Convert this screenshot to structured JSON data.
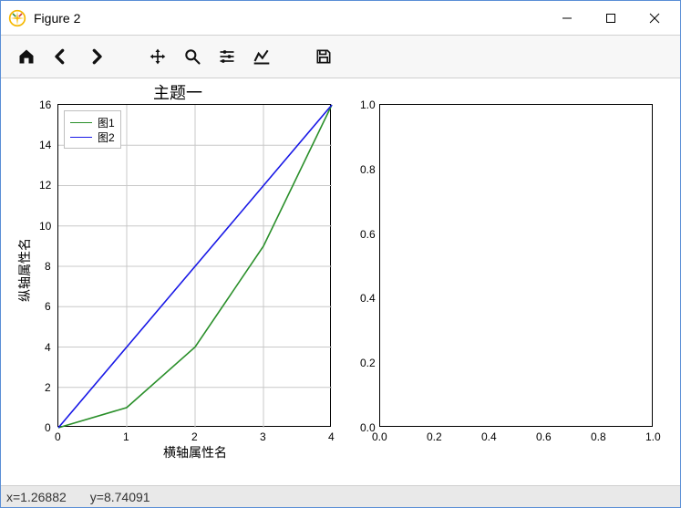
{
  "window": {
    "title": "Figure 2"
  },
  "toolbar": {
    "home": "Home",
    "back": "Back",
    "forward": "Forward",
    "pan": "Pan",
    "zoom": "Zoom",
    "subplots": "Configure subplots",
    "axes": "Edit axes",
    "save": "Save"
  },
  "status": {
    "x": "x=1.26882",
    "y": "y=8.74091"
  },
  "chart_data": [
    {
      "type": "line",
      "title": "主题一",
      "xlabel": "横轴属性名",
      "ylabel": "纵轴属性名",
      "x": [
        0,
        1,
        2,
        3,
        4
      ],
      "xlim": [
        0,
        4
      ],
      "ylim": [
        0,
        16
      ],
      "xticks": [
        0,
        1,
        2,
        3,
        4
      ],
      "yticks": [
        0,
        2,
        4,
        6,
        8,
        10,
        12,
        14,
        16
      ],
      "series": [
        {
          "name": "图1",
          "color": "#2a8f2a",
          "values": [
            0,
            1,
            4,
            9,
            16
          ]
        },
        {
          "name": "图2",
          "color": "#1818e6",
          "values": [
            0,
            4,
            8,
            12,
            16
          ]
        }
      ],
      "legend_position": "upper left"
    },
    {
      "type": "line",
      "title": "",
      "xlabel": "",
      "ylabel": "",
      "xlim": [
        0,
        1
      ],
      "ylim": [
        0,
        1
      ],
      "xticks": [
        0.0,
        0.2,
        0.4,
        0.6,
        0.8,
        1.0
      ],
      "yticks": [
        0.0,
        0.2,
        0.4,
        0.6,
        0.8,
        1.0
      ],
      "series": []
    }
  ]
}
